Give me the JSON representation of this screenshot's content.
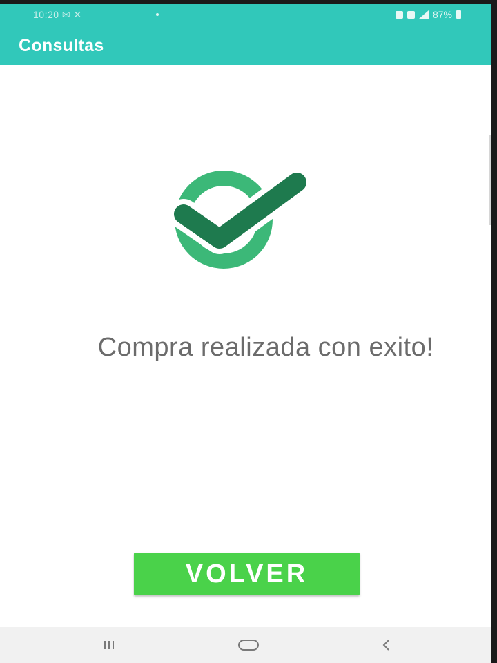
{
  "status_bar": {
    "time": "10:20 ✉ ✕",
    "battery": "87%"
  },
  "app_bar": {
    "title": "Consultas"
  },
  "main": {
    "icon": "check-circle-icon",
    "message": "Compra realizada con exito!",
    "button_label": "VOLVER"
  },
  "colors": {
    "app_bar": "#31c8ba",
    "check_circle": "#3cb878",
    "check_mark": "#1e7a4e",
    "button": "#4ad24a",
    "message_text": "#6b6b6b"
  },
  "nav_bar": {
    "recents": "recents-icon",
    "home": "home-icon",
    "back": "back-icon"
  }
}
